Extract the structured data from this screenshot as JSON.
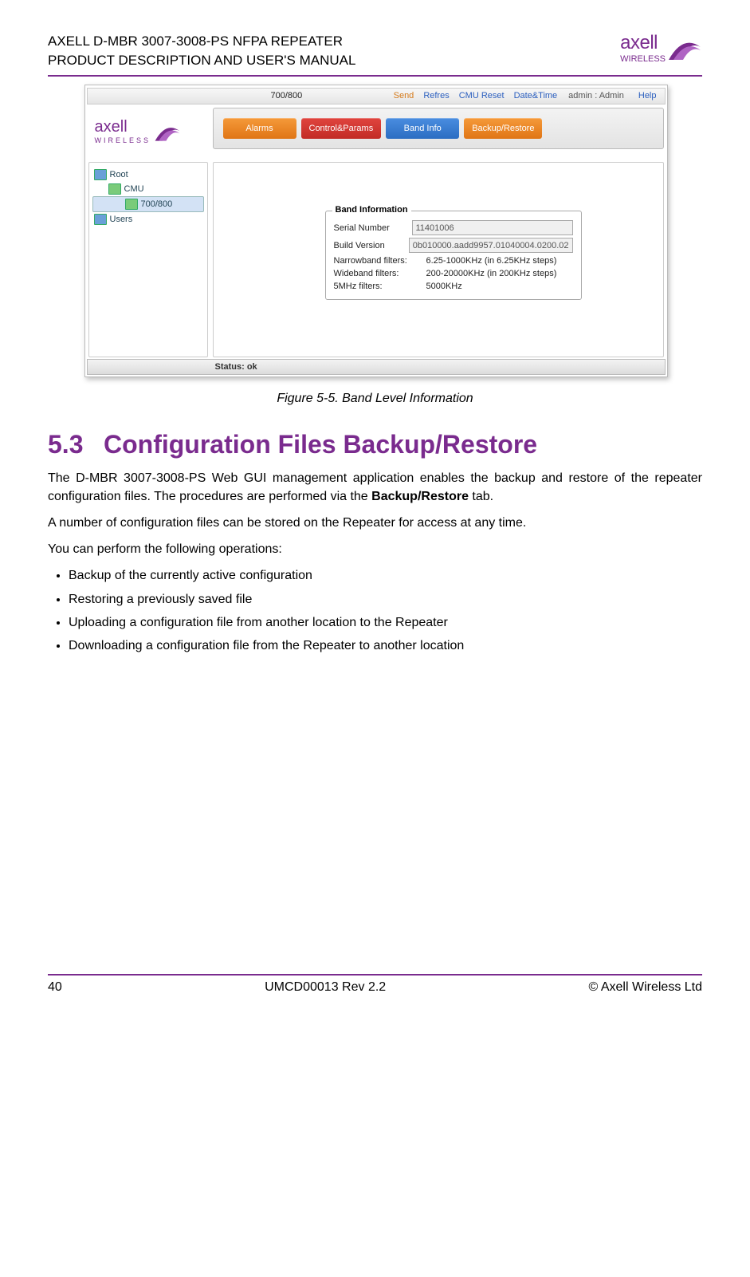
{
  "header": {
    "line1": "AXELL D-MBR 3007-3008-PS NFPA REPEATER",
    "line2": "PRODUCT DESCRIPTION AND USER'S MANUAL",
    "logo_text": "axell",
    "logo_sub": "WIRELESS"
  },
  "screenshot": {
    "topbar": {
      "band": "700/800",
      "send": "Send",
      "refresh": "Refres",
      "cmu_reset": "CMU Reset",
      "date_time": "Date&Time",
      "admin": "admin : Admin",
      "help": "Help"
    },
    "tabs": [
      "Alarms",
      "Control&Params",
      "Band Info",
      "Backup/Restore"
    ],
    "tree": {
      "root": "Root",
      "cmu": "CMU",
      "band": "700/800",
      "users": "Users"
    },
    "band_info": {
      "legend": "Band Information",
      "serial_label": "Serial Number",
      "serial_value": "11401006",
      "build_label": "Build Version",
      "build_value": "0b010000.aadd9957.01040004.0200.02",
      "narrow_label": "Narrowband filters:",
      "narrow_value": "6.25-1000KHz (in 6.25KHz steps)",
      "wide_label": "Wideband filters:",
      "wide_value": "200-20000KHz (in 200KHz steps)",
      "five_label": "5MHz filters:",
      "five_value": "5000KHz"
    },
    "status": "Status: ok"
  },
  "caption": "Figure 5-5. Band Level Information",
  "section": {
    "number": "5.3",
    "title": "Configuration Files Backup/Restore",
    "para1_a": "The D-MBR 3007-3008-PS Web GUI management application enables the backup and restore of the repeater configuration files. The procedures are performed via the ",
    "para1_b": "Backup/Restore",
    "para1_c": " tab.",
    "para2": "A number of configuration files can be stored on the Repeater for access at any time.",
    "para3": "You can perform the following operations:",
    "bullets": [
      "Backup of the currently active configuration",
      "Restoring a previously saved file",
      "Uploading a configuration file from another location to the Repeater",
      "Downloading a configuration file from the Repeater to another location"
    ]
  },
  "footer": {
    "left": "40",
    "center": "UMCD00013 Rev 2.2",
    "right": "© Axell Wireless Ltd"
  }
}
